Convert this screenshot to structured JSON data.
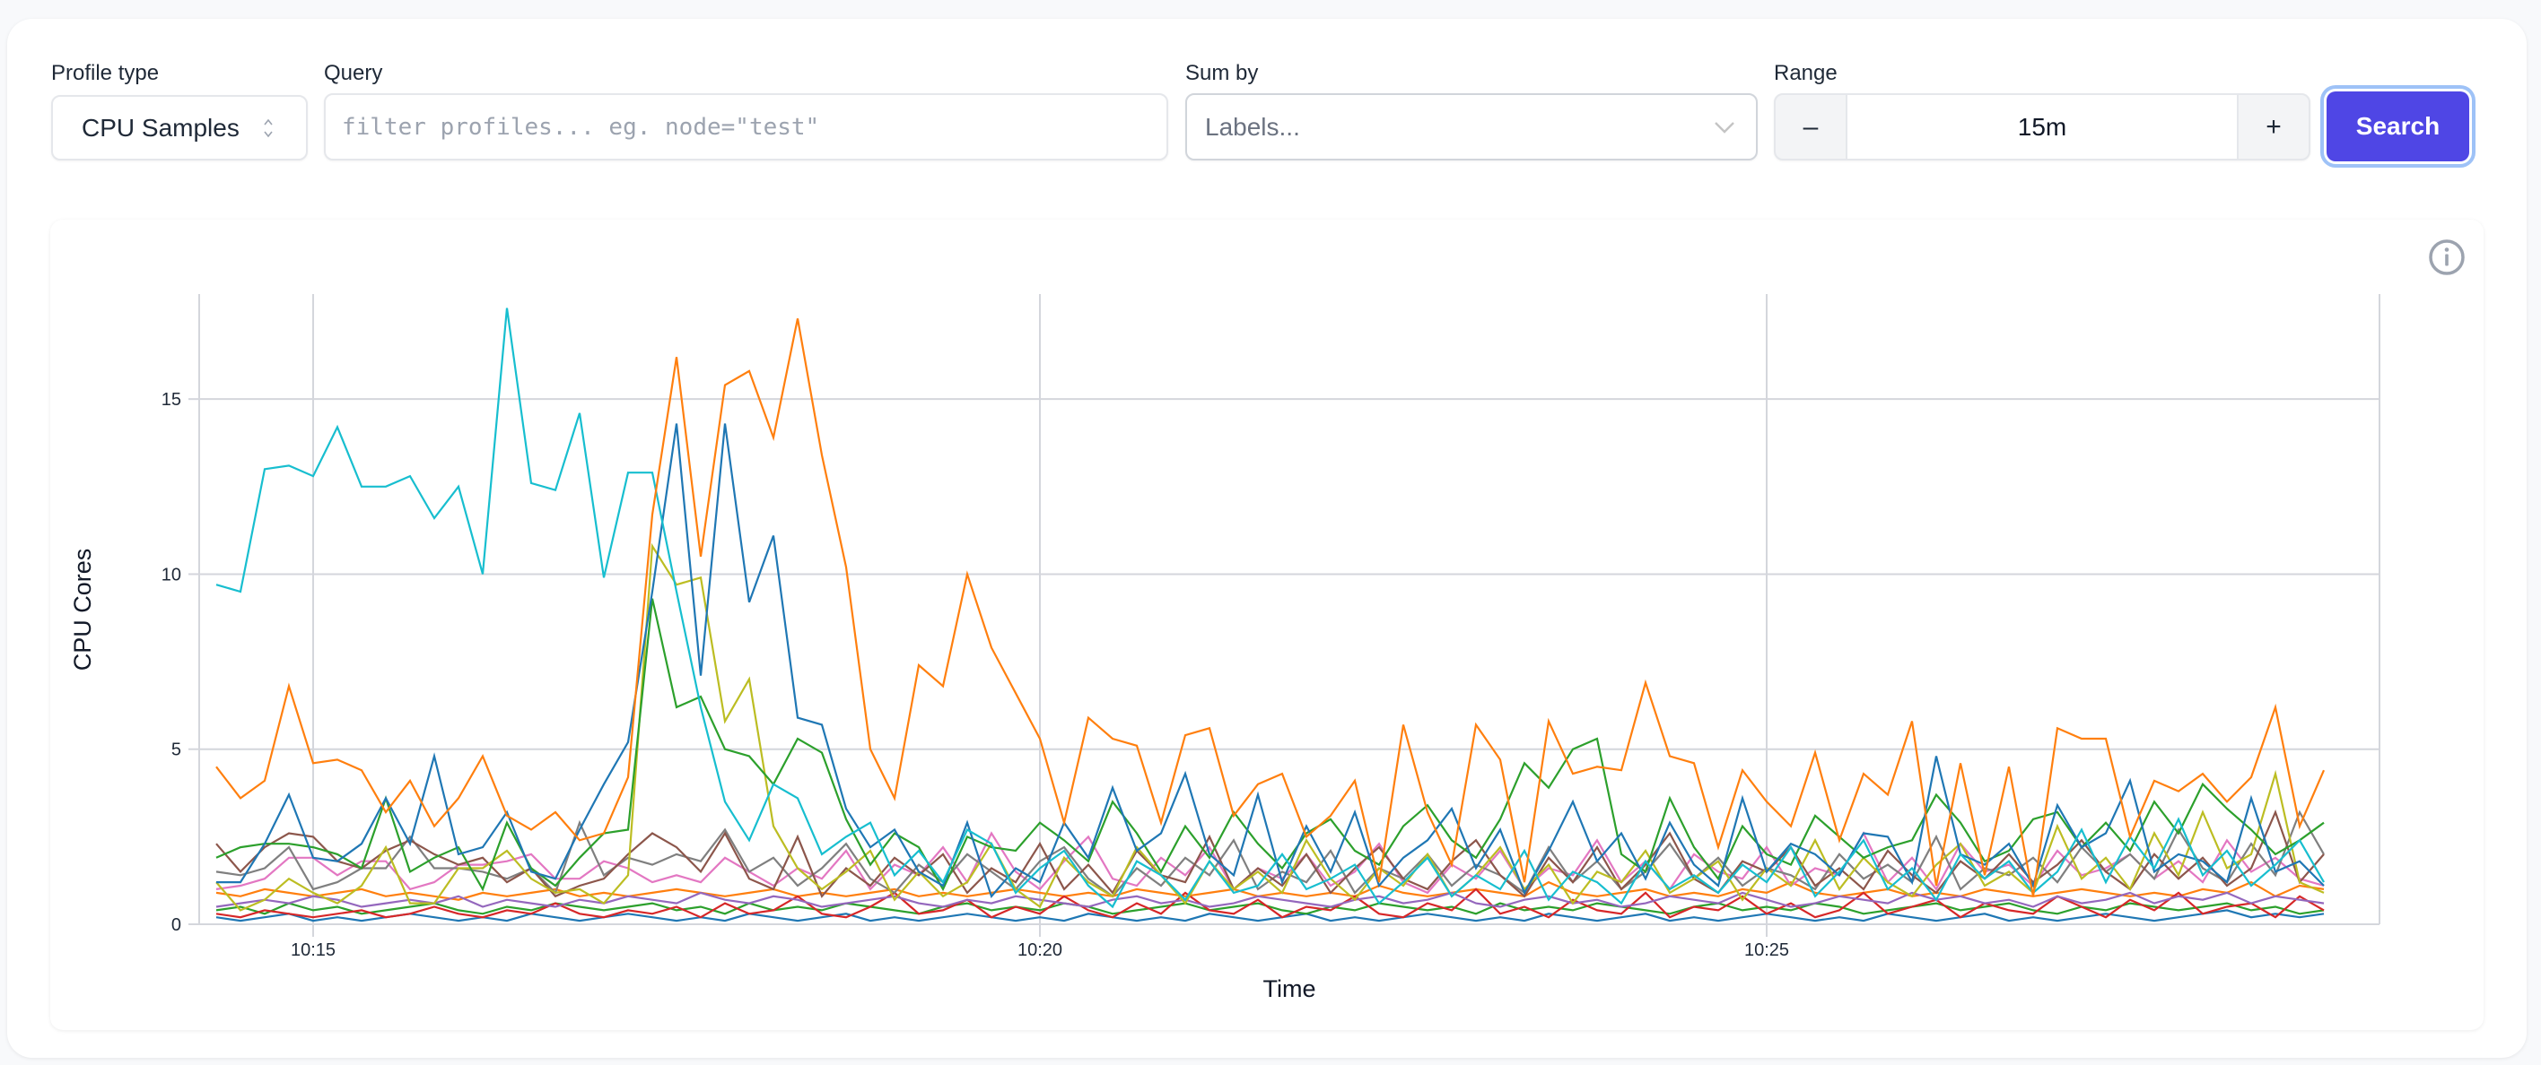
{
  "controls": {
    "profile_type": {
      "label": "Profile type",
      "value": "CPU Samples",
      "icon": "chevron-up-down-icon"
    },
    "query": {
      "label": "Query",
      "value": "",
      "placeholder": "filter profiles... eg. node=\"test\""
    },
    "sum_by": {
      "label": "Sum by",
      "placeholder": "Labels...",
      "icon": "chevron-down-icon"
    },
    "range": {
      "label": "Range",
      "value": "15m",
      "decrement_label": "–",
      "increment_label": "+"
    },
    "search_label": "Search"
  },
  "colors": {
    "accent": "#4f46e5",
    "focus_ring": "#9ec2f7"
  },
  "info_icon": "info-circle-icon",
  "chart_data": {
    "type": "line",
    "title": "",
    "xlabel": "Time",
    "ylabel": "CPU Cores",
    "ylim": [
      0,
      18
    ],
    "yticks": [
      0,
      5,
      10,
      15
    ],
    "xticks": [
      "10:15",
      "10:20",
      "10:25"
    ],
    "x_start": "10:14:20",
    "x_step_seconds": 10,
    "grid": true,
    "legend": "none",
    "series": [
      {
        "name": "series-orange",
        "color": "#ff7f0e",
        "values": [
          4.5,
          3.6,
          4.1,
          6.8,
          4.6,
          4.7,
          4.4,
          3.2,
          4.1,
          2.8,
          3.6,
          4.8,
          3.1,
          2.7,
          3.2,
          2.4,
          2.6,
          4.2,
          11.7,
          16.2,
          10.5,
          15.4,
          15.8,
          13.9,
          17.3,
          13.4,
          10.2,
          5.0,
          3.6,
          7.4,
          6.8,
          10.0,
          7.9,
          6.6,
          5.3,
          2.9,
          5.9,
          5.3,
          5.1,
          2.9,
          5.4,
          5.6,
          3.1,
          4.0,
          4.3,
          2.5,
          3.1,
          4.1,
          1.2,
          5.7,
          3.2,
          1.7,
          5.7,
          4.7,
          1.2,
          5.8,
          4.3,
          4.5,
          4.4,
          6.9,
          4.8,
          4.6,
          2.2,
          4.4,
          3.5,
          2.8,
          4.9,
          2.4,
          4.3,
          3.7,
          5.8,
          1.1,
          4.6,
          1.4,
          4.5,
          0.8,
          5.6,
          5.3,
          5.3,
          2.5,
          4.1,
          3.8,
          4.3,
          3.5,
          4.2,
          6.2,
          2.8,
          4.4
        ]
      },
      {
        "name": "series-cyan",
        "color": "#17becf",
        "values": [
          9.7,
          9.5,
          13.0,
          13.1,
          12.8,
          14.2,
          12.5,
          12.5,
          12.8,
          11.6,
          12.5,
          10.0,
          17.6,
          12.6,
          12.4,
          14.6,
          9.9,
          12.9,
          12.9,
          9.5,
          6.2,
          3.5,
          2.4,
          4.0,
          3.6,
          2.0,
          2.5,
          2.9,
          1.4,
          2.1,
          1.2,
          2.7,
          2.3,
          0.9,
          1.6,
          2.1,
          1.1,
          0.5,
          1.8,
          1.4,
          0.7,
          1.8,
          0.9,
          1.1,
          2.0,
          1.0,
          1.3,
          1.7,
          0.6,
          1.2,
          1.9,
          0.8,
          1.4,
          1.0,
          2.1,
          0.7,
          1.5,
          1.2,
          0.6,
          1.8,
          1.0,
          1.4,
          0.9,
          1.7,
          1.2,
          2.2,
          0.8,
          1.5,
          2.4,
          1.0,
          1.6,
          0.7,
          2.0,
          1.3,
          1.8,
          0.9,
          1.5,
          2.7,
          1.2,
          2.5,
          1.6,
          3.0,
          1.4,
          2.1,
          1.1,
          1.7,
          2.4,
          1.2
        ]
      },
      {
        "name": "series-blue",
        "color": "#1f77b4",
        "values": [
          1.2,
          1.2,
          2.3,
          3.7,
          1.9,
          1.8,
          2.3,
          3.6,
          2.3,
          4.8,
          2.0,
          2.2,
          3.2,
          1.5,
          1.3,
          2.7,
          4.0,
          5.2,
          9.5,
          14.3,
          7.1,
          14.3,
          9.2,
          11.1,
          5.9,
          5.7,
          3.3,
          2.2,
          2.7,
          1.5,
          1.1,
          2.9,
          0.8,
          1.6,
          1.2,
          2.9,
          1.9,
          3.9,
          2.1,
          2.6,
          4.3,
          2.0,
          1.4,
          3.7,
          1.2,
          2.8,
          1.5,
          3.2,
          1.1,
          1.9,
          2.4,
          3.3,
          1.6,
          2.7,
          0.9,
          2.1,
          3.5,
          1.8,
          2.6,
          1.3,
          2.9,
          1.7,
          1.1,
          3.6,
          1.5,
          2.3,
          2.0,
          1.4,
          2.6,
          2.5,
          1.2,
          4.8,
          2.0,
          1.7,
          2.3,
          1.1,
          3.4,
          2.2,
          2.6,
          4.1,
          1.5,
          2.0,
          1.8,
          1.2,
          3.6,
          1.5,
          1.8,
          1.1
        ]
      },
      {
        "name": "series-green",
        "color": "#2ca02c",
        "values": [
          1.9,
          2.2,
          2.3,
          2.3,
          2.2,
          2.0,
          1.6,
          3.6,
          1.5,
          1.9,
          2.2,
          1.0,
          2.9,
          1.6,
          1.1,
          1.9,
          2.6,
          2.7,
          9.3,
          6.2,
          6.5,
          5.0,
          4.8,
          4.0,
          5.3,
          4.9,
          3.0,
          1.7,
          2.6,
          2.2,
          1.0,
          2.5,
          2.2,
          2.1,
          2.9,
          2.4,
          1.8,
          3.5,
          2.6,
          1.5,
          2.8,
          1.9,
          3.2,
          2.3,
          1.6,
          2.6,
          3.0,
          2.1,
          1.7,
          2.8,
          3.4,
          2.4,
          1.9,
          3.0,
          4.6,
          3.9,
          5.0,
          5.3,
          2.0,
          1.5,
          3.6,
          2.2,
          1.3,
          2.8,
          2.0,
          1.7,
          3.1,
          2.5,
          1.9,
          2.2,
          2.4,
          3.7,
          2.9,
          1.8,
          2.1,
          3.0,
          3.2,
          2.2,
          2.9,
          2.1,
          3.5,
          2.6,
          4.0,
          3.3,
          2.7,
          2.0,
          2.4,
          2.9
        ]
      },
      {
        "name": "series-olive",
        "color": "#bcbd22",
        "values": [
          1.2,
          0.4,
          0.7,
          1.3,
          0.9,
          0.6,
          1.1,
          2.2,
          0.6,
          0.6,
          1.6,
          1.6,
          2.1,
          1.3,
          0.9,
          1.0,
          0.6,
          1.4,
          10.8,
          9.7,
          9.9,
          5.8,
          7.0,
          2.8,
          1.6,
          1.0,
          1.5,
          2.1,
          0.7,
          1.5,
          0.8,
          1.2,
          2.3,
          1.0,
          0.5,
          1.9,
          1.2,
          0.8,
          2.2,
          1.4,
          0.6,
          1.8,
          1.0,
          1.5,
          0.9,
          2.4,
          1.3,
          0.7,
          1.6,
          1.1,
          2.0,
          0.8,
          1.4,
          2.2,
          1.0,
          1.7,
          0.6,
          1.5,
          1.2,
          2.1,
          0.9,
          1.3,
          1.8,
          0.7,
          1.6,
          1.1,
          2.4,
          1.0,
          1.9,
          1.2,
          0.8,
          1.7,
          2.3,
          1.1,
          1.5,
          0.9,
          2.8,
          1.3,
          1.9,
          1.0,
          2.6,
          1.4,
          3.2,
          1.6,
          2.0,
          4.3,
          1.2,
          0.9
        ]
      },
      {
        "name": "series-brown",
        "color": "#8c564b",
        "values": [
          2.3,
          1.5,
          2.2,
          2.6,
          2.5,
          1.8,
          1.6,
          2.1,
          2.4,
          2.0,
          1.7,
          1.9,
          1.2,
          1.6,
          0.8,
          1.1,
          1.3,
          2.0,
          2.6,
          2.2,
          1.5,
          2.6,
          1.3,
          1.0,
          2.5,
          0.8,
          1.6,
          1.1,
          1.9,
          1.4,
          2.0,
          0.9,
          1.6,
          1.2,
          2.3,
          1.0,
          1.7,
          0.9,
          2.1,
          1.4,
          1.2,
          2.5,
          1.0,
          1.6,
          1.1,
          2.0,
          0.9,
          1.6,
          2.2,
          1.3,
          1.0,
          1.8,
          2.4,
          1.4,
          0.8,
          1.9,
          1.2,
          2.2,
          1.0,
          1.7,
          2.6,
          1.3,
          0.9,
          1.8,
          1.5,
          2.2,
          1.1,
          1.6,
          1.0,
          2.1,
          1.4,
          0.9,
          1.8,
          1.3,
          2.0,
          1.2,
          1.7,
          2.4,
          1.5,
          1.0,
          2.0,
          1.3,
          1.9,
          1.1,
          1.6,
          3.2,
          1.2,
          2.0
        ]
      },
      {
        "name": "series-gray",
        "color": "#7f7f7f",
        "values": [
          1.5,
          1.4,
          1.6,
          2.2,
          1.0,
          1.2,
          1.6,
          1.6,
          2.5,
          1.6,
          1.6,
          1.5,
          1.3,
          1.6,
          0.9,
          2.9,
          1.4,
          1.9,
          1.7,
          2.0,
          1.8,
          2.7,
          1.5,
          1.9,
          1.1,
          1.6,
          2.3,
          1.3,
          0.9,
          1.7,
          1.2,
          2.0,
          1.5,
          1.0,
          1.8,
          2.2,
          1.3,
          0.8,
          1.6,
          1.1,
          1.9,
          1.4,
          2.4,
          1.0,
          1.5,
          1.2,
          2.1,
          0.9,
          1.6,
          1.3,
          2.0,
          1.1,
          1.7,
          1.4,
          0.9,
          2.2,
          1.2,
          1.8,
          1.0,
          1.5,
          2.3,
          1.3,
          1.9,
          1.1,
          1.6,
          1.4,
          1.0,
          2.0,
          1.3,
          1.7,
          1.2,
          2.5,
          1.0,
          1.6,
          1.4,
          1.9,
          1.2,
          2.2,
          1.5,
          2.0,
          1.3,
          2.7,
          1.6,
          1.2,
          2.3,
          1.4,
          3.2,
          2.0
        ]
      },
      {
        "name": "series-pink",
        "color": "#e377c2",
        "values": [
          1.0,
          1.1,
          1.3,
          1.9,
          1.9,
          1.4,
          1.8,
          1.8,
          1.0,
          1.2,
          1.7,
          1.7,
          1.8,
          2.0,
          1.3,
          1.3,
          1.8,
          1.6,
          1.2,
          1.4,
          1.2,
          1.9,
          1.5,
          1.1,
          1.6,
          1.3,
          2.1,
          1.0,
          1.7,
          1.4,
          2.2,
          1.2,
          2.6,
          1.5,
          1.0,
          1.8,
          2.5,
          1.3,
          1.1,
          1.9,
          1.4,
          2.2,
          1.0,
          1.6,
          1.3,
          2.0,
          1.1,
          1.5,
          2.3,
          1.2,
          0.9,
          1.7,
          1.3,
          2.1,
          1.0,
          1.6,
          1.4,
          2.4,
          1.2,
          1.8,
          1.0,
          2.0,
          1.5,
          1.3,
          2.2,
          1.1,
          1.6,
          1.4,
          2.6,
          1.2,
          1.9,
          1.0,
          2.3,
          1.5,
          1.7,
          1.1,
          2.1,
          1.4,
          1.6,
          2.0,
          1.3,
          1.8,
          1.2,
          2.4,
          1.5,
          1.9,
          1.3,
          1.1
        ]
      },
      {
        "name": "series-purple",
        "color": "#9467bd",
        "values": [
          0.5,
          0.6,
          0.7,
          0.6,
          0.8,
          0.7,
          0.5,
          0.6,
          0.7,
          0.6,
          0.8,
          0.5,
          0.7,
          0.6,
          0.5,
          0.7,
          0.6,
          0.8,
          0.7,
          0.6,
          0.9,
          0.7,
          0.6,
          0.8,
          0.7,
          0.5,
          0.6,
          0.7,
          0.8,
          0.6,
          0.5,
          0.7,
          0.6,
          0.8,
          0.7,
          0.6,
          0.5,
          0.7,
          0.8,
          0.6,
          0.7,
          0.5,
          0.6,
          0.8,
          0.7,
          0.6,
          0.5,
          0.7,
          0.8,
          0.6,
          0.7,
          0.9,
          0.6,
          0.5,
          0.7,
          0.8,
          0.6,
          0.7,
          0.5,
          0.6,
          0.8,
          0.7,
          0.6,
          0.9,
          0.7,
          0.5,
          0.6,
          0.8,
          0.7,
          0.6,
          0.9,
          0.7,
          0.8,
          0.6,
          0.7,
          0.5,
          0.8,
          0.6,
          0.7,
          0.9,
          0.6,
          0.8,
          0.7,
          0.9,
          0.6,
          0.8,
          0.7,
          0.6
        ]
      },
      {
        "name": "series-red",
        "color": "#d62728",
        "values": [
          0.3,
          0.2,
          0.4,
          0.3,
          0.2,
          0.3,
          0.4,
          0.2,
          0.3,
          0.5,
          0.3,
          0.2,
          0.4,
          0.3,
          0.6,
          0.3,
          0.2,
          0.4,
          0.3,
          0.5,
          0.2,
          0.6,
          0.3,
          0.4,
          0.8,
          0.3,
          0.2,
          0.5,
          0.9,
          0.3,
          0.4,
          0.7,
          0.2,
          0.5,
          0.3,
          0.8,
          0.4,
          0.2,
          0.6,
          0.3,
          0.9,
          0.4,
          0.3,
          0.7,
          0.2,
          0.5,
          0.4,
          0.8,
          0.3,
          0.2,
          0.6,
          0.4,
          1.0,
          0.3,
          0.5,
          0.2,
          0.7,
          0.4,
          0.3,
          0.9,
          0.2,
          0.5,
          0.4,
          0.8,
          0.3,
          0.6,
          0.2,
          0.4,
          0.9,
          0.3,
          0.5,
          0.7,
          0.2,
          0.6,
          0.4,
          0.3,
          0.8,
          0.5,
          0.2,
          0.7,
          0.4,
          0.9,
          0.3,
          0.5,
          0.6,
          0.2,
          0.8,
          0.4
        ]
      },
      {
        "name": "series-orange-low",
        "color": "#ff7f0e",
        "values": [
          0.9,
          0.8,
          1.0,
          0.9,
          0.8,
          0.9,
          1.0,
          0.8,
          0.9,
          0.8,
          0.7,
          0.9,
          0.8,
          0.9,
          1.0,
          0.8,
          0.9,
          0.8,
          0.9,
          1.0,
          0.9,
          0.8,
          0.9,
          1.0,
          0.8,
          0.9,
          0.8,
          0.9,
          1.0,
          0.8,
          0.9,
          0.8,
          0.9,
          1.0,
          0.9,
          0.8,
          0.9,
          0.8,
          1.0,
          0.9,
          0.8,
          0.9,
          1.0,
          0.8,
          0.9,
          0.8,
          0.9,
          0.8,
          1.1,
          0.9,
          0.8,
          0.9,
          1.0,
          0.9,
          0.8,
          1.2,
          0.9,
          0.8,
          0.9,
          1.0,
          0.8,
          0.9,
          0.8,
          1.0,
          0.9,
          1.2,
          0.9,
          0.8,
          0.9,
          1.0,
          0.8,
          0.9,
          0.8,
          1.0,
          0.9,
          0.8,
          0.9,
          1.0,
          0.9,
          0.8,
          0.9,
          0.8,
          1.0,
          0.9,
          1.2,
          0.8,
          1.1,
          1.0
        ]
      },
      {
        "name": "series-green-low",
        "color": "#2ca02c",
        "values": [
          0.4,
          0.5,
          0.3,
          0.6,
          0.4,
          0.5,
          0.3,
          0.4,
          0.5,
          0.6,
          0.4,
          0.3,
          0.5,
          0.4,
          0.6,
          0.5,
          0.4,
          0.5,
          0.6,
          0.4,
          0.5,
          0.3,
          0.6,
          0.4,
          0.5,
          0.4,
          0.6,
          0.5,
          0.4,
          0.3,
          0.5,
          0.6,
          0.4,
          0.5,
          0.4,
          0.6,
          0.5,
          0.3,
          0.4,
          0.5,
          0.6,
          0.4,
          0.5,
          0.6,
          0.4,
          0.3,
          0.5,
          0.4,
          0.6,
          0.5,
          0.4,
          0.5,
          0.3,
          0.6,
          0.4,
          0.5,
          0.4,
          0.6,
          0.5,
          0.4,
          0.3,
          0.5,
          0.6,
          0.4,
          0.5,
          0.4,
          0.6,
          0.5,
          0.3,
          0.4,
          0.5,
          0.6,
          0.4,
          0.5,
          0.6,
          0.4,
          0.3,
          0.5,
          0.4,
          0.6,
          0.5,
          0.4,
          0.5,
          0.6,
          0.4,
          0.5,
          0.3,
          0.4
        ]
      },
      {
        "name": "series-blue-low",
        "color": "#1f77b4",
        "values": [
          0.2,
          0.1,
          0.2,
          0.3,
          0.1,
          0.2,
          0.1,
          0.2,
          0.3,
          0.2,
          0.1,
          0.2,
          0.1,
          0.3,
          0.2,
          0.1,
          0.2,
          0.3,
          0.2,
          0.1,
          0.2,
          0.1,
          0.3,
          0.2,
          0.1,
          0.2,
          0.3,
          0.1,
          0.2,
          0.1,
          0.2,
          0.3,
          0.2,
          0.1,
          0.2,
          0.1,
          0.3,
          0.2,
          0.1,
          0.2,
          0.1,
          0.3,
          0.2,
          0.1,
          0.2,
          0.3,
          0.1,
          0.2,
          0.1,
          0.2,
          0.3,
          0.2,
          0.1,
          0.2,
          0.1,
          0.3,
          0.2,
          0.1,
          0.2,
          0.3,
          0.1,
          0.2,
          0.1,
          0.2,
          0.3,
          0.2,
          0.1,
          0.2,
          0.1,
          0.3,
          0.2,
          0.1,
          0.2,
          0.3,
          0.1,
          0.2,
          0.1,
          0.2,
          0.3,
          0.2,
          0.1,
          0.2,
          0.3,
          0.4,
          0.2,
          0.3,
          0.2,
          0.3
        ]
      }
    ]
  }
}
